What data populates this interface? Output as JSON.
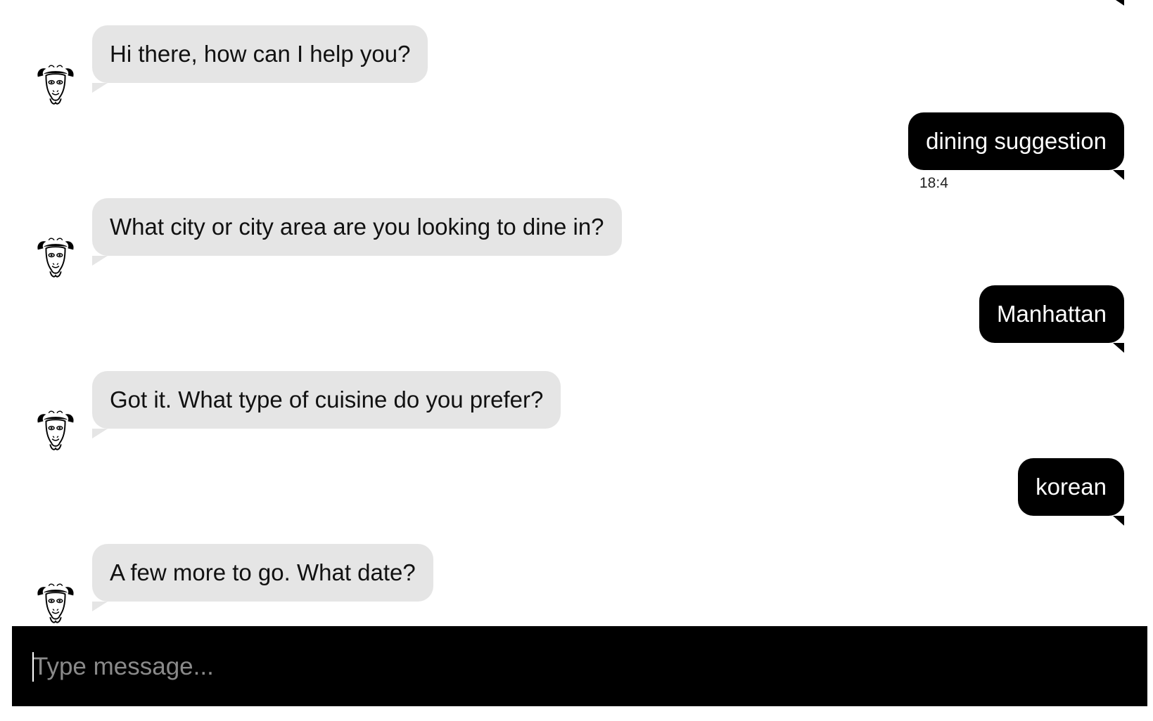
{
  "conversation": {
    "messages": [
      {
        "sender": "bot",
        "text": "Hi there, how can I help you?"
      },
      {
        "sender": "user",
        "text": "dining suggestion",
        "timestamp": "18:4"
      },
      {
        "sender": "bot",
        "text": "What city or city area are you looking to dine in?"
      },
      {
        "sender": "user",
        "text": "Manhattan"
      },
      {
        "sender": "bot",
        "text": "Got it. What type of cuisine do you prefer?"
      },
      {
        "sender": "user",
        "text": "korean"
      },
      {
        "sender": "bot",
        "text": "A few more to go. What date?"
      }
    ]
  },
  "composer": {
    "placeholder": "Type message...",
    "value": ""
  },
  "icons": {
    "bot_avatar": "gnu-head-icon"
  },
  "colors": {
    "bot_bubble": "#e5e5e5",
    "user_bubble": "#000000",
    "composer_bg": "#000000",
    "placeholder": "#8a8a8a"
  }
}
